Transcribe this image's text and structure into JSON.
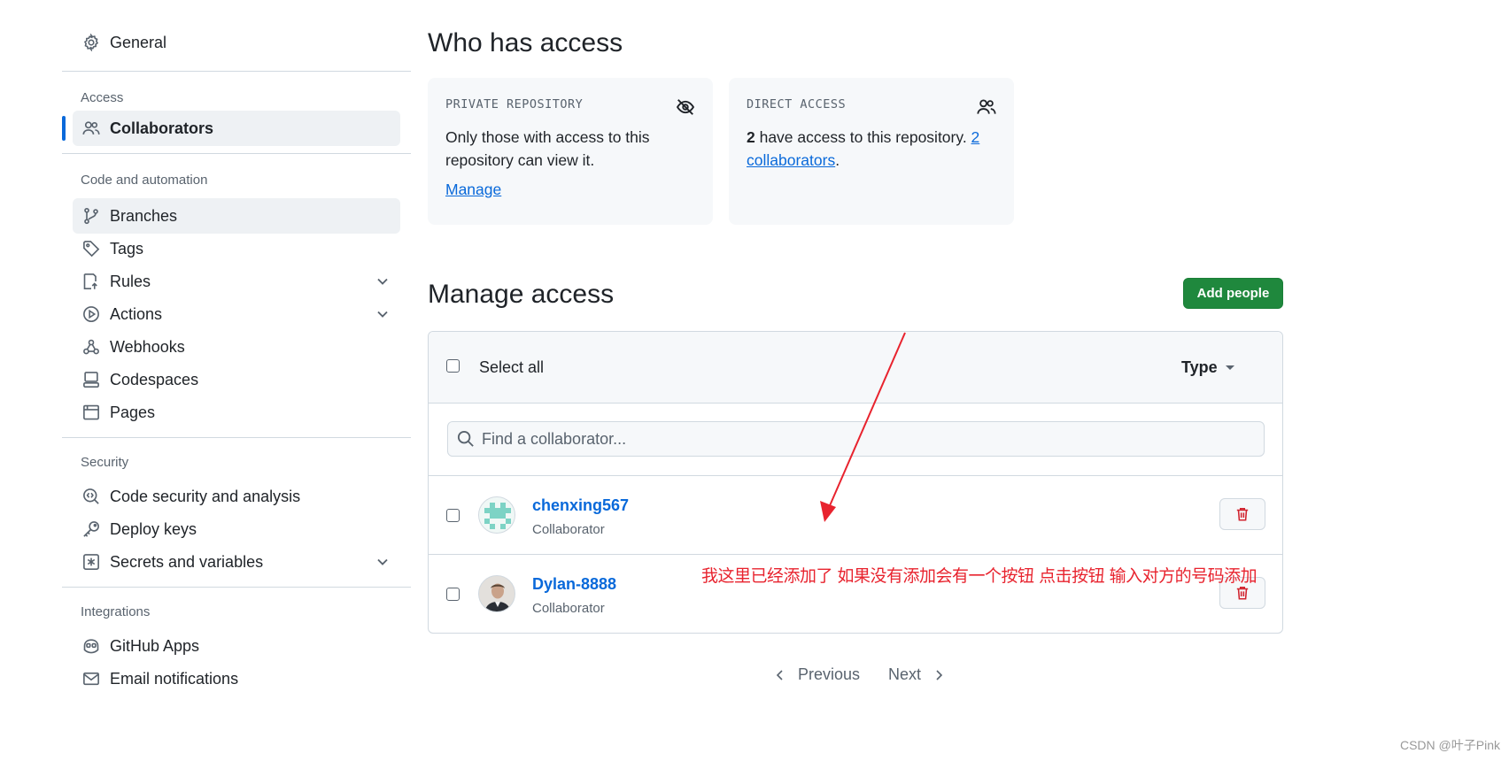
{
  "sidebar": {
    "general": "General",
    "access_heading": "Access",
    "collaborators": "Collaborators",
    "code_heading": "Code and automation",
    "code_items": [
      "Branches",
      "Tags",
      "Rules",
      "Actions",
      "Webhooks",
      "Codespaces",
      "Pages"
    ],
    "security_heading": "Security",
    "security_items": [
      "Code security and analysis",
      "Deploy keys",
      "Secrets and variables"
    ],
    "integrations_heading": "Integrations",
    "integrations_items": [
      "GitHub Apps",
      "Email notifications"
    ]
  },
  "who": {
    "title": "Who has access",
    "private": {
      "label": "PRIVATE REPOSITORY",
      "text": "Only those with access to this repository can view it.",
      "link": "Manage"
    },
    "direct": {
      "label": "DIRECT ACCESS",
      "count": "2",
      "text": " have access to this repository. ",
      "link": "2 collaborators",
      "end": "."
    }
  },
  "manage": {
    "title": "Manage access",
    "add_button": "Add people",
    "select_all": "Select all",
    "type": "Type",
    "search_placeholder": "Find a collaborator...",
    "rows": [
      {
        "name": "chenxing567",
        "role": "Collaborator"
      },
      {
        "name": "Dylan-8888",
        "role": "Collaborator"
      }
    ]
  },
  "pager": {
    "previous": "Previous",
    "next": "Next"
  },
  "annotation": "我这里已经添加了 如果没有添加会有一个按钮 点击按钮 输入对方的号码添加",
  "watermark": "CSDN @叶子Pink",
  "colors": {
    "accent": "#0969da",
    "primary_button": "#1f883d",
    "annotation": "#e8232e",
    "danger": "#d1242f"
  }
}
